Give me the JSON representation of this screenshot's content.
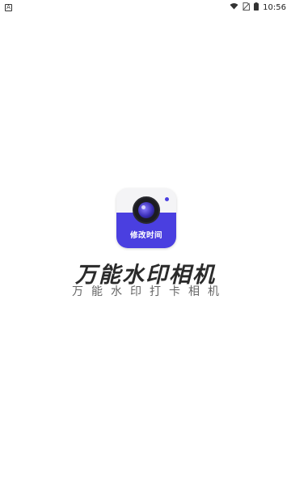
{
  "status_bar": {
    "notification_icon": "A",
    "time": "10:56",
    "icons": [
      "wifi-icon",
      "no-sim-icon",
      "battery-icon"
    ]
  },
  "splash": {
    "app_icon": {
      "label": "修改时间",
      "accent_color": "#4a3fe0"
    },
    "title": "万能水印相机",
    "subtitle": "万能水印打卡相机"
  }
}
